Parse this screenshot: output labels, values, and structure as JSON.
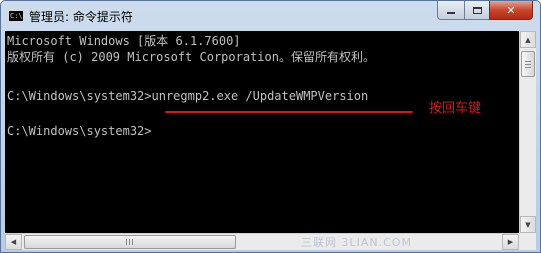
{
  "window": {
    "title": "管理员: 命令提示符",
    "icon_label": "C:\\",
    "close_glyph": "✕"
  },
  "console": {
    "lines": [
      "Microsoft Windows [版本 6.1.7600]",
      "版权所有 (c) 2009 Microsoft Corporation。保留所有权利。",
      "",
      "C:\\Windows\\system32>unregmp2.exe /UpdateWMPVersion",
      "",
      "C:\\Windows\\system32>"
    ],
    "text_color": "#c0c0c0",
    "background": "#000000"
  },
  "annotation": {
    "text": "按回车键",
    "color": "#d11a1a"
  },
  "scrollbars": {
    "up_glyph": "▲",
    "down_glyph": "▼",
    "left_glyph": "◀",
    "right_glyph": "▶"
  },
  "watermark": {
    "text": "三联网 3LIAN.COM"
  }
}
